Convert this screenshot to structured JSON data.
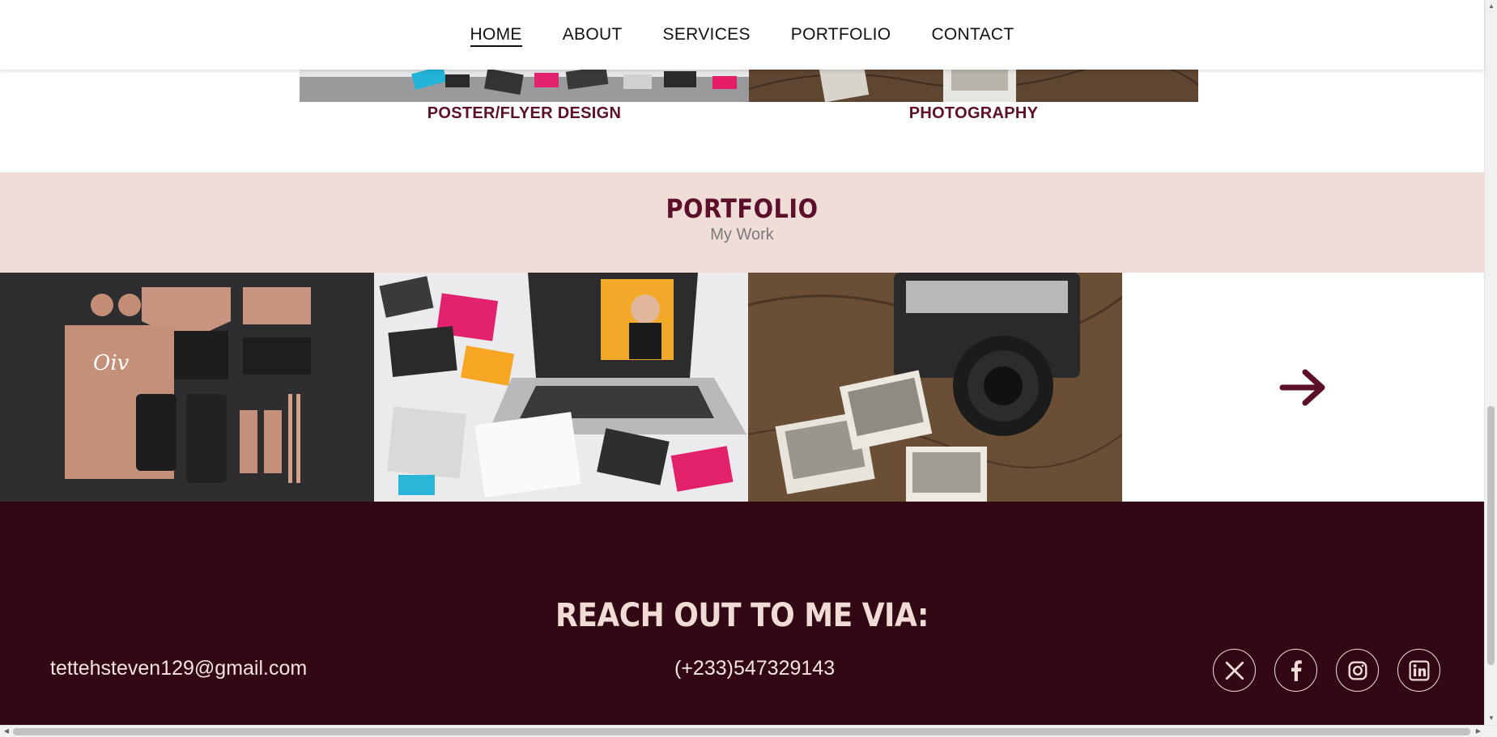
{
  "nav": {
    "items": [
      {
        "label": "HOME",
        "active": true
      },
      {
        "label": "ABOUT"
      },
      {
        "label": "SERVICES"
      },
      {
        "label": "PORTFOLIO"
      },
      {
        "label": "CONTACT"
      }
    ]
  },
  "services": {
    "captions": [
      "POSTER/FLYER DESIGN",
      "PHOTOGRAPHY"
    ]
  },
  "portfolio": {
    "title": "PORTFOLIO",
    "subtitle": "My Work",
    "images": [
      "branding-stationery-image",
      "poster-flyer-design-image",
      "photography-camera-map-image"
    ],
    "next_icon": "arrow-right-icon"
  },
  "footer": {
    "title": "REACH OUT TO ME VIA:",
    "email": "tettehsteven129@gmail.com",
    "phone": "(+233)547329143",
    "socials": [
      "x-twitter-icon",
      "facebook-icon",
      "instagram-icon",
      "linkedin-icon"
    ]
  },
  "colors": {
    "brand": "#5c0f2a",
    "footer_bg": "#310813",
    "portfolio_bg": "#f0ddd7",
    "footer_text": "#f1ddd7"
  }
}
